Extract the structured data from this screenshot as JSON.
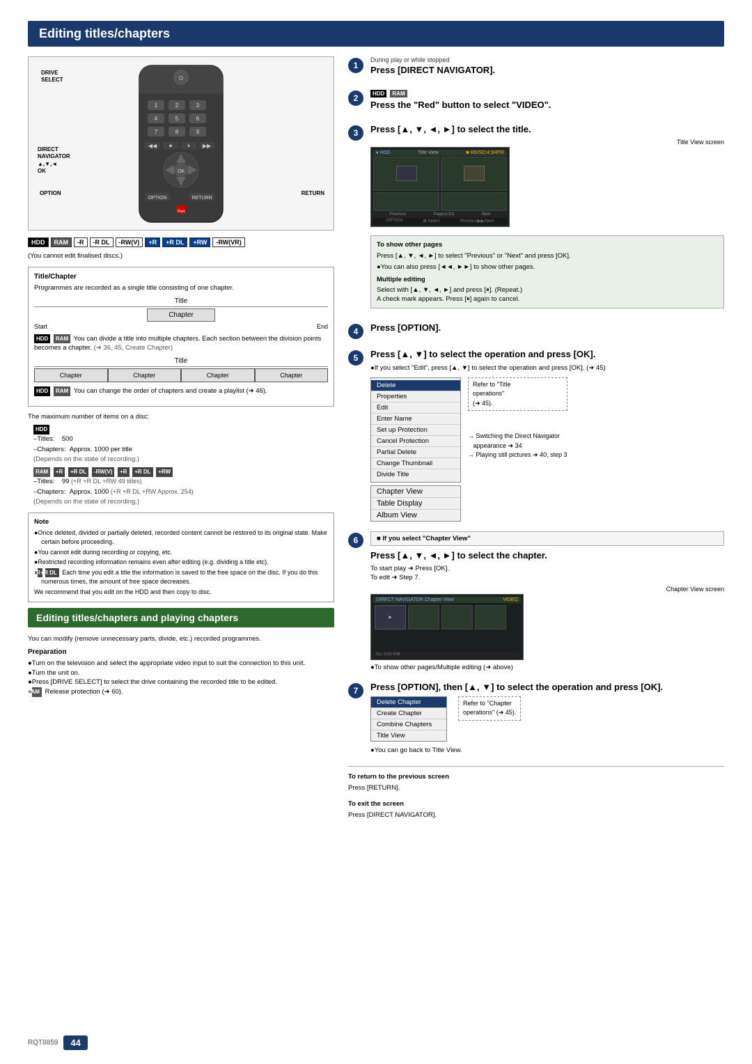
{
  "page": {
    "number": "44",
    "model": "RQT8859"
  },
  "header": {
    "title": "Editing titles/chapters"
  },
  "left": {
    "compat_bar": [
      "HDD",
      "RAM",
      "-R",
      "-R DL",
      "-RW(V)",
      "+R",
      "+R DL",
      "+RW",
      "-RW(VR)"
    ],
    "compat_note": "(You cannot edit finalised discs.)",
    "title_chapter": {
      "heading": "Title/Chapter",
      "desc": "Programmes are recorded as a single title consisting of one chapter.",
      "title_label": "Title",
      "chapter_label": "Chapter",
      "start_label": "Start",
      "end_label": "End",
      "desc2_badge1": "HDD",
      "desc2_badge2": "RAM",
      "desc2": "You can divide a title into multiple chapters. Each section between the division points becomes a chapter.",
      "desc2_ref": "(➜ 36, 45, Create Chapter)",
      "title_label2": "Title",
      "chapter_labels": [
        "Chapter",
        "Chapter",
        "Chapter",
        "Chapter"
      ],
      "desc3_badge1": "HDD",
      "desc3_badge2": "RAM",
      "desc3": "You can change the order of chapters and create a playlist (➜ 46)."
    },
    "max_items": {
      "title": "The maximum number of items on a disc:",
      "hdd_title": "HDD",
      "titles_hdd": "–Titles:\t500",
      "chapters_hdd": "–Chapters:\tApprox. 1000 per title",
      "depends1": "(Depends on the state of recording.)",
      "ram_badges": [
        "RAM",
        "+R",
        "+R DL",
        "-RW(V)",
        "+R",
        "+R DL",
        "+RW"
      ],
      "titles_ram": "–Titles:\t99",
      "titles_ram2": "(+R +R DL +RW 49 titles)",
      "chapters_ram": "–Chapters:\tApprox. 1000",
      "chapters_ram2": "(+R +R DL +RW Approx. 254)",
      "depends2": "(Depends on the state of recording.)"
    },
    "note": {
      "title": "Note",
      "items": [
        "Once deleted, divided or partially deleted, recorded content cannot be restored to its original state. Make certain before proceeding.",
        "You cannot edit during recording or copying, etc.",
        "Restricted recording information remains even after editing (e.g. dividing a title etc).",
        "+R +R DL Each time you edit a title the information is saved to the free space on the disc. If you do this numerous times, the amount of free space decreases.",
        "We recommend that you edit on the HDD and then copy to disc."
      ]
    },
    "section2": {
      "title": "Editing titles/chapters and playing chapters",
      "desc": "You can modify (remove unnecessary parts, divide, etc.) recorded programmes.",
      "prep_title": "Preparation",
      "prep_items": [
        "Turn on the television and select the appropriate video input to suit the connection to this unit.",
        "Turn the unit on.",
        "Press [DRIVE SELECT] to select the drive containing the recorded title to be edited.",
        "RAM Release protection (➜ 60)."
      ]
    }
  },
  "right": {
    "steps": [
      {
        "num": "1",
        "subtitle": "During play or while stopped",
        "main": "Press [DIRECT NAVIGATOR]."
      },
      {
        "num": "2",
        "badges": [
          "HDD",
          "RAM"
        ],
        "main": "Press the \"Red\" button to select \"VIDEO\"."
      },
      {
        "num": "3",
        "main": "Press [▲, ▼, ◄, ►] to select the title.",
        "screen_label": "Title View screen",
        "screen_header_left": "♦ HDD",
        "screen_header_right": "Title View",
        "show_other_pages": {
          "title": "To show other pages",
          "desc1": "Press [▲, ▼, ◄, ►] to select \"Previous\" or \"Next\" and press [OK].",
          "bullet1": "You can also press [◄◄, ►►] to show other pages.",
          "multi_edit_title": "Multiple editing",
          "multi_edit_desc": "Select with [▲, ▼, ◄, ►] and press [⏸]. (Repeat.)",
          "multi_edit_desc2": "A check mark appears. Press [⏸] again to cancel."
        }
      },
      {
        "num": "4",
        "main": "Press [OPTION]."
      },
      {
        "num": "5",
        "main": "Press [▲, ▼] to select the operation and press [OK].",
        "note": "●If you select \"Edit\", press [▲, ▼] to select the operation and press [OK]. (➜ 45)",
        "menu": {
          "items": [
            "Enter Name",
            "Set up Protection",
            "Cancel Protection",
            "Partial Delete",
            "Change Thumbnail",
            "Divide Title"
          ],
          "selected": "Delete",
          "other_items": [
            "Properties",
            "Edit"
          ]
        },
        "annotations": [
          {
            "label": "Delete",
            "note_items": [
              "Refer to \"Title operations\" (➜ 45)."
            ]
          }
        ],
        "sub_items": [
          "Chapter View",
          "Table Display",
          "Album View"
        ],
        "switch_note": "Switching the Direct Navigator appearance ➜ 34",
        "playing_note": "Playing still pictures ➜ 40, step 3"
      },
      {
        "num": "6",
        "if_select": "■ If you select \"Chapter View\"",
        "main": "Press [▲, ▼, ◄, ►] to select the chapter.",
        "start_play": "To start play ➜ Press [OK].",
        "to_edit": "To edit ➜ Step 7.",
        "screen_label": "Chapter View screen",
        "screen_header_left": "DIRECT NAVIGATOR  Chapter View",
        "screen_header_right": "VIDEO",
        "show_other": "●To show other pages/Multiple editing (➜ above)"
      },
      {
        "num": "7",
        "main": "Press [OPTION], then [▲, ▼] to select the operation and press [OK].",
        "menu": {
          "items": [
            "Delete Chapter",
            "Create Chapter",
            "Combine Chapters",
            "Title View"
          ],
          "selected": "Delete Chapter"
        },
        "annotation": "Refer to \"Chapter operations\" (➜ 45).",
        "note": "●You can go back to Title View."
      }
    ],
    "bottom": {
      "return_title": "To return to the previous screen",
      "return_desc": "Press [RETURN].",
      "exit_title": "To exit the screen",
      "exit_desc": "Press [DIRECT NAVIGATOR]."
    }
  }
}
